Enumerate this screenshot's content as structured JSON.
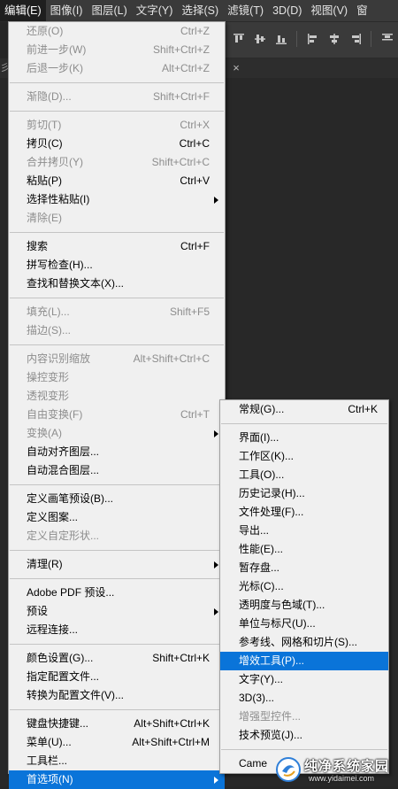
{
  "menubar": {
    "items": [
      {
        "label": "编辑(E)",
        "active": true
      },
      {
        "label": "图像(I)"
      },
      {
        "label": "图层(L)"
      },
      {
        "label": "文字(Y)"
      },
      {
        "label": "选择(S)"
      },
      {
        "label": "滤镜(T)"
      },
      {
        "label": "3D(D)"
      },
      {
        "label": "视图(V)"
      },
      {
        "label": "窗"
      }
    ]
  },
  "document": {
    "tab_partial_label": "彡",
    "close_icon": "close-icon"
  },
  "edit_menu": {
    "groups": [
      [
        {
          "label": "还原(O)",
          "shortcut": "Ctrl+Z",
          "disabled": true
        },
        {
          "label": "前进一步(W)",
          "shortcut": "Shift+Ctrl+Z",
          "disabled": true
        },
        {
          "label": "后退一步(K)",
          "shortcut": "Alt+Ctrl+Z",
          "disabled": true
        }
      ],
      [
        {
          "label": "渐隐(D)...",
          "shortcut": "Shift+Ctrl+F",
          "disabled": true
        }
      ],
      [
        {
          "label": "剪切(T)",
          "shortcut": "Ctrl+X",
          "disabled": true
        },
        {
          "label": "拷贝(C)",
          "shortcut": "Ctrl+C"
        },
        {
          "label": "合并拷贝(Y)",
          "shortcut": "Shift+Ctrl+C",
          "disabled": true
        },
        {
          "label": "粘贴(P)",
          "shortcut": "Ctrl+V"
        },
        {
          "label": "选择性粘贴(I)",
          "submenu": true
        },
        {
          "label": "清除(E)",
          "disabled": true
        }
      ],
      [
        {
          "label": "搜索",
          "shortcut": "Ctrl+F"
        },
        {
          "label": "拼写检查(H)..."
        },
        {
          "label": "查找和替换文本(X)..."
        }
      ],
      [
        {
          "label": "填充(L)...",
          "shortcut": "Shift+F5",
          "disabled": true
        },
        {
          "label": "描边(S)...",
          "disabled": true
        }
      ],
      [
        {
          "label": "内容识别缩放",
          "shortcut": "Alt+Shift+Ctrl+C",
          "disabled": true
        },
        {
          "label": "操控变形",
          "disabled": true
        },
        {
          "label": "透视变形",
          "disabled": true
        },
        {
          "label": "自由变换(F)",
          "shortcut": "Ctrl+T",
          "disabled": true
        },
        {
          "label": "变换(A)",
          "submenu": true,
          "disabled": true
        },
        {
          "label": "自动对齐图层..."
        },
        {
          "label": "自动混合图层..."
        }
      ],
      [
        {
          "label": "定义画笔预设(B)..."
        },
        {
          "label": "定义图案..."
        },
        {
          "label": "定义自定形状...",
          "disabled": true
        }
      ],
      [
        {
          "label": "清理(R)",
          "submenu": true
        }
      ],
      [
        {
          "label": "Adobe PDF 预设..."
        },
        {
          "label": "预设",
          "submenu": true
        },
        {
          "label": "远程连接..."
        }
      ],
      [
        {
          "label": "颜色设置(G)...",
          "shortcut": "Shift+Ctrl+K"
        },
        {
          "label": "指定配置文件..."
        },
        {
          "label": "转换为配置文件(V)..."
        }
      ],
      [
        {
          "label": "键盘快捷键...",
          "shortcut": "Alt+Shift+Ctrl+K"
        },
        {
          "label": "菜单(U)...",
          "shortcut": "Alt+Shift+Ctrl+M"
        },
        {
          "label": "工具栏..."
        },
        {
          "label": "首选项(N)",
          "submenu": true,
          "highlight": true
        }
      ]
    ]
  },
  "preferences_submenu": {
    "groups": [
      [
        {
          "label": "常规(G)...",
          "shortcut": "Ctrl+K"
        }
      ],
      [
        {
          "label": "界面(I)..."
        },
        {
          "label": "工作区(K)..."
        },
        {
          "label": "工具(O)..."
        },
        {
          "label": "历史记录(H)..."
        },
        {
          "label": "文件处理(F)..."
        },
        {
          "label": "导出..."
        },
        {
          "label": "性能(E)..."
        },
        {
          "label": "暂存盘..."
        },
        {
          "label": "光标(C)..."
        },
        {
          "label": "透明度与色域(T)..."
        },
        {
          "label": "单位与标尺(U)..."
        },
        {
          "label": "参考线、网格和切片(S)..."
        },
        {
          "label": "增效工具(P)...",
          "highlight": true
        },
        {
          "label": "文字(Y)..."
        },
        {
          "label": "3D(3)..."
        },
        {
          "label": "增强型控件...",
          "disabled": true
        },
        {
          "label": "技术预览(J)..."
        }
      ],
      [
        {
          "label": "Came"
        }
      ]
    ]
  },
  "watermark": {
    "title": "纯净系统家园",
    "url": "www.yidaimei.com"
  },
  "colors": {
    "menubar_bg": "#3a3a3a",
    "menu_bg": "#f0f0f0",
    "highlight": "#0a74d9",
    "disabled_text": "#8d8d8d"
  }
}
